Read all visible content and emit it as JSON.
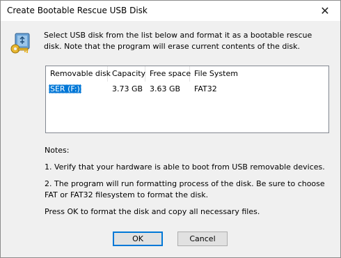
{
  "window": {
    "title": "Create Bootable Rescue USB Disk",
    "close_glyph": "✕"
  },
  "intro": {
    "text": "Select USB disk from the list below and format it as a bootable rescue disk. Note that the program will erase current contents of the disk."
  },
  "disk_list": {
    "columns": [
      "Removable disk",
      "Capacity",
      "Free space",
      "File System"
    ],
    "rows": [
      {
        "disk": "SER (F:)",
        "capacity": "3.73 GB",
        "free": "3.63 GB",
        "fs": "FAT32",
        "selected": true
      }
    ]
  },
  "notes": {
    "heading": "Notes:",
    "item1": "1. Verify that your hardware is able to boot from USB removable devices.",
    "item2": "2. The program will run formatting process of the disk. Be sure to choose FAT or FAT32 filesystem to format the disk.",
    "footer": "Press OK to format the disk and copy all necessary files."
  },
  "buttons": {
    "ok": "OK",
    "cancel": "Cancel"
  },
  "icons": {
    "app": "usb-key-icon",
    "close": "close-icon"
  },
  "colors": {
    "selection": "#0078d7",
    "default_button_border": "#0078d7"
  }
}
